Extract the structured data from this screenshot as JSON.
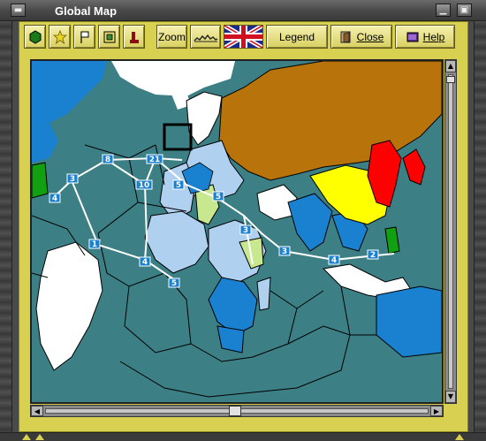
{
  "window": {
    "title": "Global Map"
  },
  "toolbar": {
    "zoom_label": "Zoom",
    "legend_label": "Legend",
    "close_label": "Close",
    "help_label": "Help"
  },
  "routes": {
    "labels": [
      "8",
      "21",
      "3",
      "10",
      "4",
      "5",
      "5",
      "1",
      "3",
      "4",
      "3",
      "4",
      "2",
      "5"
    ]
  },
  "colors": {
    "sea": "#3c7f85",
    "neutral_land": "#ffffff",
    "allies_blue": "#1a80d0",
    "allies_lightblue": "#b0d0f0",
    "soviet_orange": "#b8730b",
    "japan_red": "#ff0000",
    "china_yellow": "#ffff00",
    "green": "#10a010",
    "pale_green": "#c8e890",
    "panel_yellow": "#d8d050"
  }
}
